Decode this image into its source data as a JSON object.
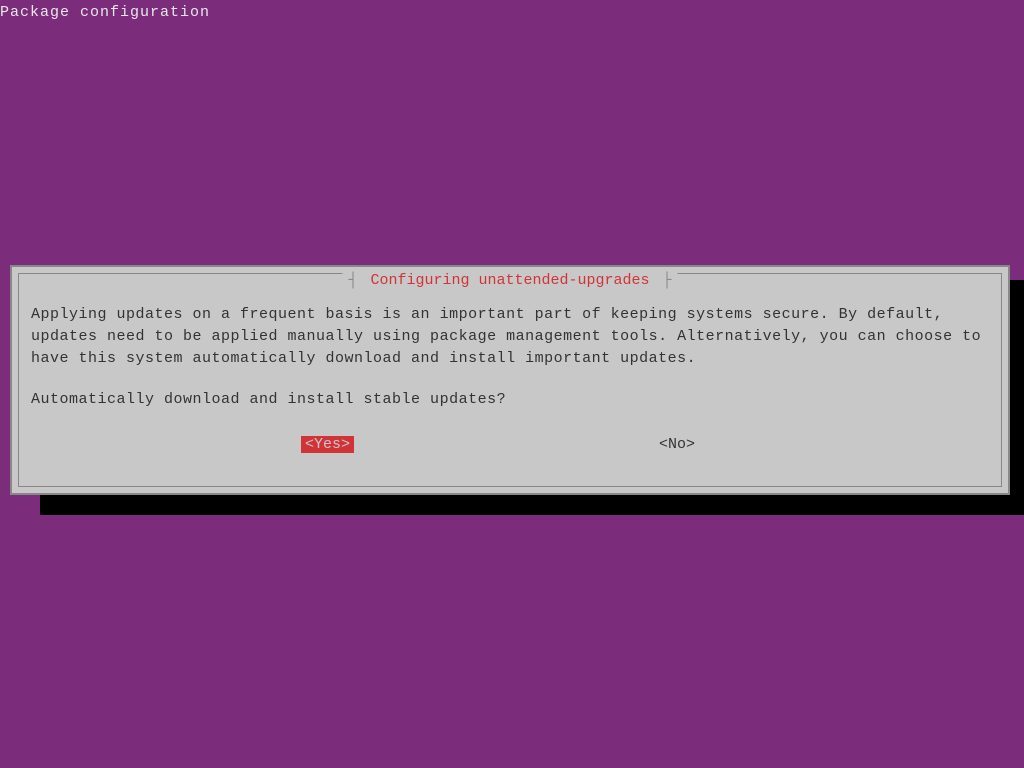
{
  "header": {
    "title": "Package configuration"
  },
  "dialog": {
    "title": "Configuring unattended-upgrades",
    "title_deco_left": "┤",
    "title_deco_right": "├",
    "text": "Applying updates on a frequent basis is an important part of keeping systems secure. By default, updates need to be applied manually using package management tools. Alternatively, you can choose to have this system automatically download and install important updates.",
    "prompt": "Automatically download and install stable updates?",
    "buttons": {
      "yes": "<Yes>",
      "no": "<No>"
    }
  },
  "colors": {
    "background": "#7b2d7b",
    "dialog_bg": "#c8c8c8",
    "accent_red": "#d13438",
    "text_dark": "#333333",
    "text_light": "#e8e8e8",
    "border": "#888888"
  }
}
